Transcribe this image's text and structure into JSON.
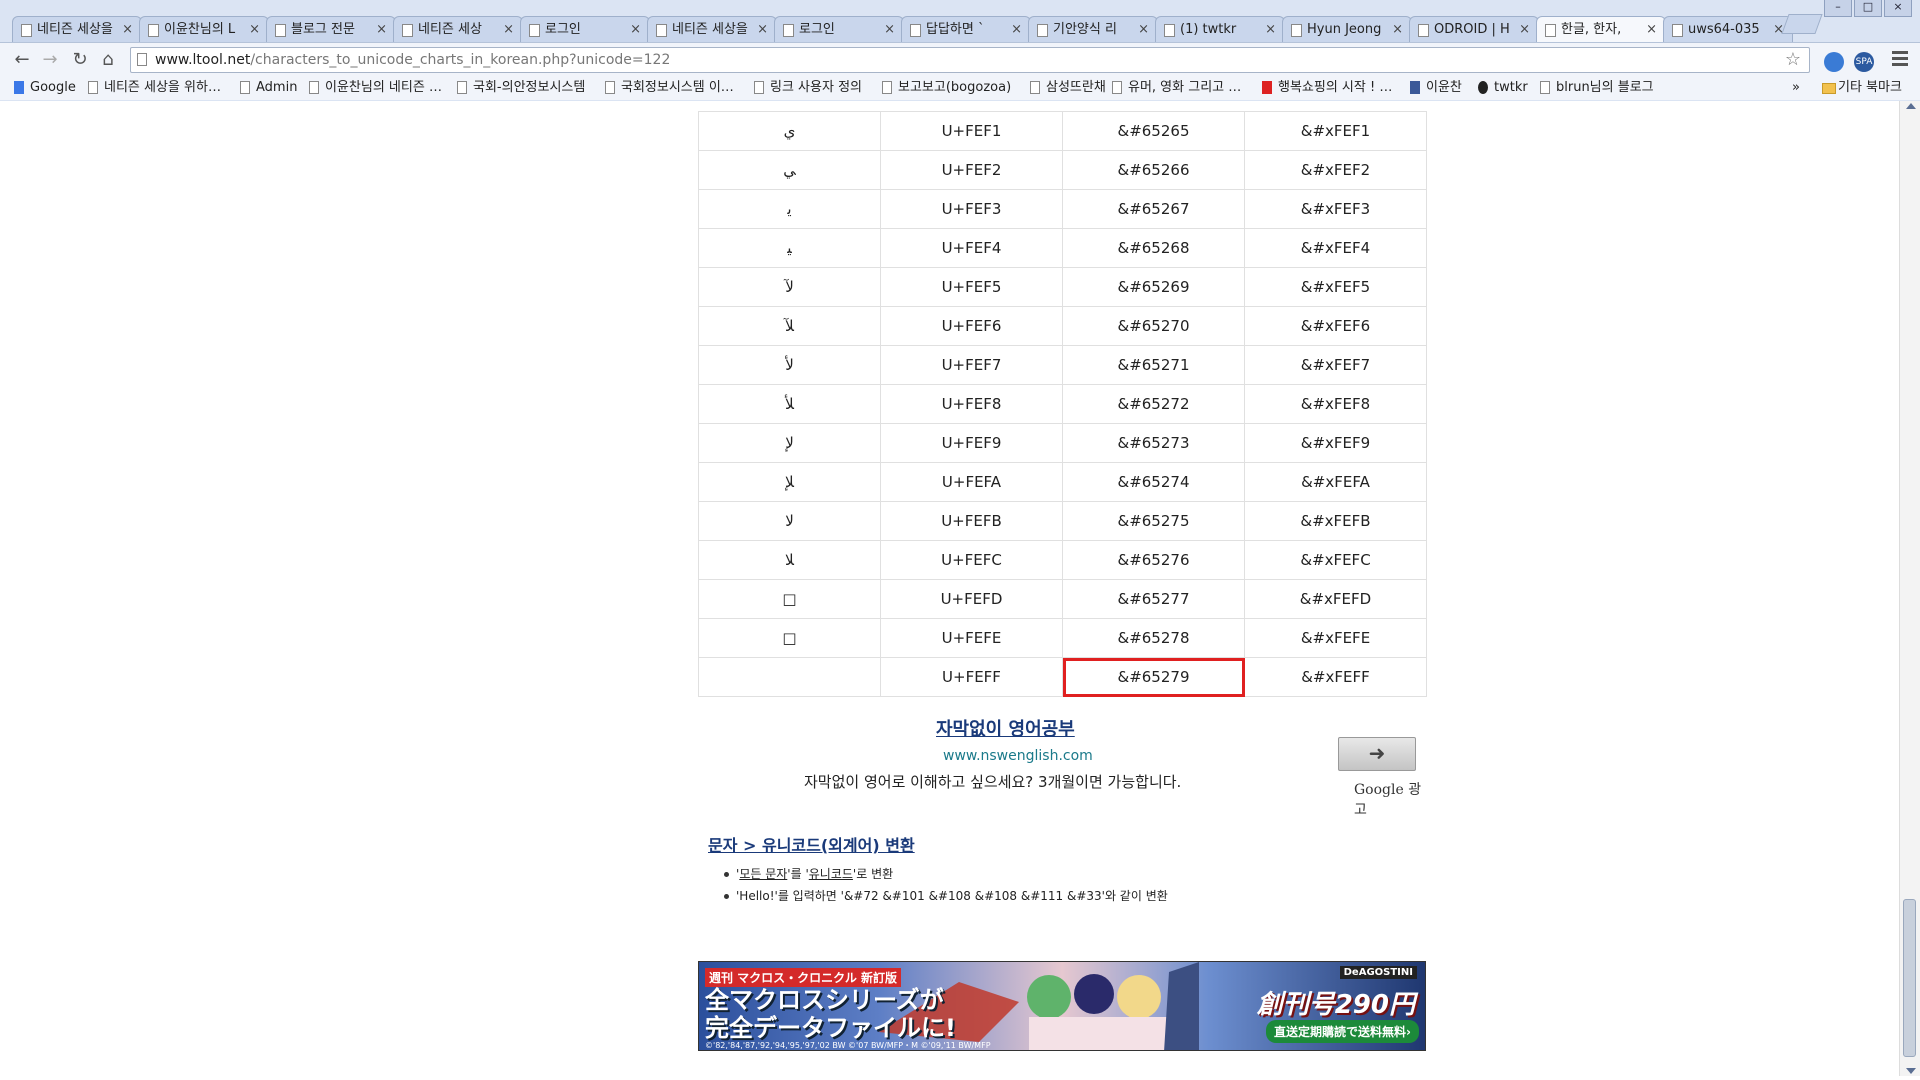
{
  "browser": {
    "tabs": [
      {
        "title": "네티즌 세상을",
        "active": false
      },
      {
        "title": "이윤찬님의 L",
        "active": false
      },
      {
        "title": "블로그 전문",
        "active": false
      },
      {
        "title": "네티즌 세상",
        "active": false
      },
      {
        "title": "로그인",
        "active": false
      },
      {
        "title": "네티즌 세상을",
        "active": false
      },
      {
        "title": "로그인",
        "active": false
      },
      {
        "title": "답답하면 `",
        "active": false
      },
      {
        "title": "기안양식 리",
        "active": false
      },
      {
        "title": "(1) twtkr",
        "active": false
      },
      {
        "title": "Hyun Jeong",
        "active": false
      },
      {
        "title": "ODROID | H",
        "active": false
      },
      {
        "title": "한글, 한자,",
        "active": true
      },
      {
        "title": "uws64-035",
        "active": false
      }
    ],
    "tab_close_glyph": "×",
    "window_controls": {
      "minimize": "–",
      "maximize": "□",
      "close": "×"
    },
    "nav": {
      "back": "←",
      "forward": "→",
      "reload": "↻",
      "home": "⌂"
    },
    "url_host": "www.ltool.net",
    "url_path": "/characters_to_unicode_charts_in_korean.php?unicode=122",
    "star": "☆",
    "ext_spa": "SPA",
    "bookmarks": [
      {
        "label": "Google",
        "icon": "g"
      },
      {
        "label": "네티즌 세상을 위하…",
        "icon": "page"
      },
      {
        "label": "Admin",
        "icon": "page"
      },
      {
        "label": "이윤찬님의 네티즌 …",
        "icon": "page"
      },
      {
        "label": "국회-의안정보시스템",
        "icon": "page"
      },
      {
        "label": "국회정보시스템 이…",
        "icon": "page"
      },
      {
        "label": "링크 사용자 정의",
        "icon": "page"
      },
      {
        "label": "보고보고(bogozoa)",
        "icon": "page"
      },
      {
        "label": "삼성뜨란채",
        "icon": "page"
      },
      {
        "label": "유머, 영화 그리고 …",
        "icon": "page"
      },
      {
        "label": "행복쇼핑의 시작 ! …",
        "icon": "red"
      },
      {
        "label": "이윤찬",
        "icon": "fb"
      },
      {
        "label": "twtkr",
        "icon": "tw"
      },
      {
        "label": "blrun님의 블로그",
        "icon": "page"
      }
    ],
    "bookmarks_more": "»",
    "other_bookmarks": "기타 북마크"
  },
  "table": {
    "rows": [
      {
        "char": "ﻱ",
        "code": "U+FEF1",
        "dec": "&#65265",
        "hex": "&#xFEF1"
      },
      {
        "char": "ﻲ",
        "code": "U+FEF2",
        "dec": "&#65266",
        "hex": "&#xFEF2"
      },
      {
        "char": "ﻳ",
        "code": "U+FEF3",
        "dec": "&#65267",
        "hex": "&#xFEF3"
      },
      {
        "char": "ﻴ",
        "code": "U+FEF4",
        "dec": "&#65268",
        "hex": "&#xFEF4"
      },
      {
        "char": "ﻵ",
        "code": "U+FEF5",
        "dec": "&#65269",
        "hex": "&#xFEF5"
      },
      {
        "char": "ﻶ",
        "code": "U+FEF6",
        "dec": "&#65270",
        "hex": "&#xFEF6"
      },
      {
        "char": "ﻷ",
        "code": "U+FEF7",
        "dec": "&#65271",
        "hex": "&#xFEF7"
      },
      {
        "char": "ﻸ",
        "code": "U+FEF8",
        "dec": "&#65272",
        "hex": "&#xFEF8"
      },
      {
        "char": "ﻹ",
        "code": "U+FEF9",
        "dec": "&#65273",
        "hex": "&#xFEF9"
      },
      {
        "char": "ﻺ",
        "code": "U+FEFA",
        "dec": "&#65274",
        "hex": "&#xFEFA"
      },
      {
        "char": "ﻻ",
        "code": "U+FEFB",
        "dec": "&#65275",
        "hex": "&#xFEFB"
      },
      {
        "char": "ﻼ",
        "code": "U+FEFC",
        "dec": "&#65276",
        "hex": "&#xFEFC"
      },
      {
        "char": "□",
        "code": "U+FEFD",
        "dec": "&#65277",
        "hex": "&#xFEFD"
      },
      {
        "char": "□",
        "code": "U+FEFE",
        "dec": "&#65278",
        "hex": "&#xFEFE"
      },
      {
        "char": "",
        "code": "U+FEFF",
        "dec": "&#65279",
        "hex": "&#xFEFF"
      }
    ],
    "highlight_color": "#e02020"
  },
  "ad": {
    "title": "자막없이 영어공부",
    "url": "www.nswenglish.com",
    "description": "자막없이 영어로 이해하고 싶으세요? 3개월이면 가능합니다.",
    "arrow": "➜",
    "google_label": "Google 광고"
  },
  "section": {
    "title": "문자 > 유니코드(외계어) 변환",
    "bullet1_pre": "'",
    "bullet1_link1": "모든 문자",
    "bullet1_mid": "'를 '",
    "bullet1_link2": "유니코드",
    "bullet1_post": "'로 변환",
    "bullet2": "'Hello!'를 입력하면 '&#72 &#101 &#108 &#108 &#111 &#33'와 같이 변환"
  },
  "banner": {
    "small_label": "週刊 マクロス・クロニクル 新訂版",
    "headline_line1": "全マクロスシリーズが",
    "headline_line2": "完全データファイルに!",
    "brand": "DeAGOSTINI",
    "price": "創刊号290円",
    "cta": "直送定期購読で送料無料›",
    "footer": "©'82,'84,'87,'92,'94,'95,'97,'02 BW ©'07 BW/MFP・M ©'09,'11 BW/MFP"
  }
}
